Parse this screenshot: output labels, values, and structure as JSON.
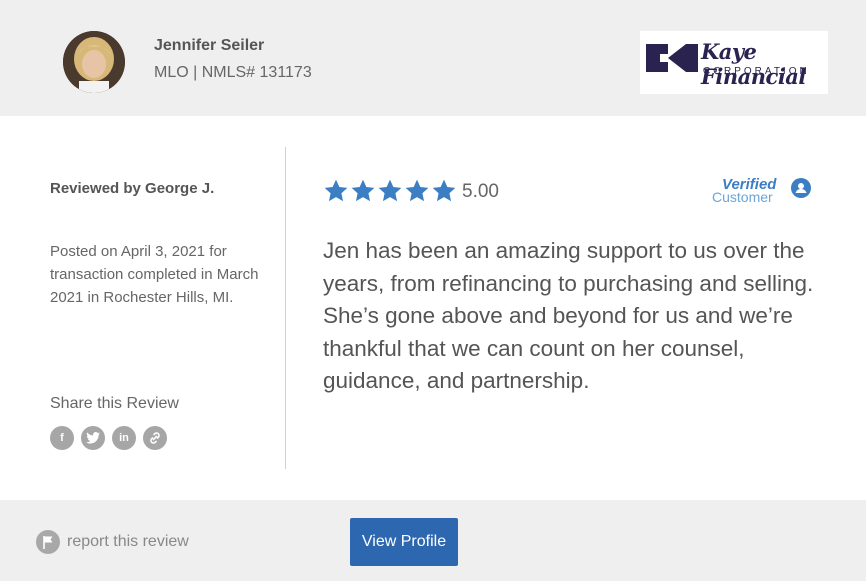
{
  "agent": {
    "name": "Jennifer Seiler",
    "license": "MLO | NMLS# 131173"
  },
  "company_logo": {
    "name": "Kaye Financial",
    "subtitle": "CORPORATION"
  },
  "review": {
    "reviewer": "Reviewed by George J.",
    "posted": "Posted on April 3, 2021 for transaction completed in March 2021 in Rochester Hills, MI.",
    "rating": 5,
    "rating_label": "5.00",
    "text": "Jen has been an amazing support to us over the years, from refinancing to purchasing and selling. She’s gone above and beyond for us and we’re thankful that we can count on her counsel, guidance, and partnership."
  },
  "verified_badge": {
    "top": "Verified",
    "bottom": "Customer"
  },
  "share": {
    "label": "Share this Review",
    "icons": [
      "facebook-icon",
      "twitter-icon",
      "linkedin-icon",
      "link-icon"
    ]
  },
  "footer": {
    "report_label": "report this review",
    "view_profile_label": "View Profile"
  },
  "colors": {
    "star": "#3c7ec3",
    "button": "#2c67b0",
    "header_bg": "#efefef"
  }
}
